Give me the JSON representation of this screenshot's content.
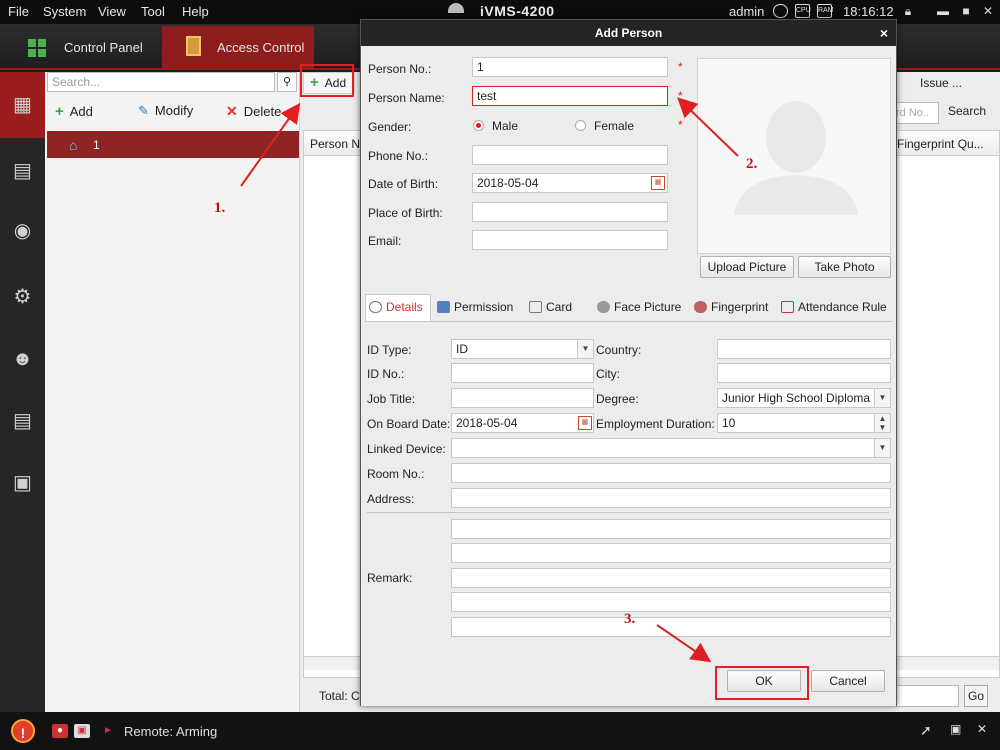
{
  "menubar": {
    "items": [
      "File",
      "System",
      "View",
      "Tool",
      "Help"
    ],
    "app_title": "iVMS-4200",
    "user": "admin",
    "icons": [
      "network-icon",
      "cpu-icon",
      "ram-icon"
    ],
    "cpu_label": "CPU",
    "ram_label": "RAM",
    "clock": "18:16:12"
  },
  "tabs": [
    {
      "label": "Control Panel",
      "icon": "grid-icon"
    },
    {
      "label": "Access Control",
      "icon": "door-icon"
    }
  ],
  "leftnav": [
    "org-icon",
    "schedule-icon",
    "shield-icon",
    "settings-icon",
    "person-search-icon",
    "report-icon",
    "device-icon"
  ],
  "orgpane": {
    "search_placeholder": "Search...",
    "add": "Add",
    "modify": "Modify",
    "delete": "Delete",
    "org_row": "1"
  },
  "rightpane": {
    "add_top": "Add",
    "issue": "Issue ...",
    "search_placeholder": "rd No..",
    "search_btn": "Search",
    "col_person": "Person N",
    "col_fingerprint": "Fingerprint Qu...",
    "total": "Total: C",
    "go": "Go"
  },
  "statusbar": {
    "warn_symbol": "!",
    "remote": "Remote: Arming"
  },
  "dialog": {
    "title": "Add Person",
    "close": "×",
    "person_no_label": "Person No.:",
    "person_no": "1",
    "person_name_label": "Person Name:",
    "person_name": "test",
    "gender_label": "Gender:",
    "male": "Male",
    "female": "Female",
    "gender_selected": "Male",
    "phone_label": "Phone No.:",
    "phone": "",
    "dob_label": "Date of Birth:",
    "dob": "2018-05-04",
    "pob_label": "Place of Birth:",
    "pob": "",
    "email_label": "Email:",
    "email": "",
    "required_mark": "*",
    "upload_picture": "Upload Picture",
    "take_photo": "Take Photo",
    "tabs": [
      "Details",
      "Permission",
      "Card",
      "Face Picture",
      "Fingerprint",
      "Attendance Rule"
    ],
    "active_tab": "Details",
    "details": {
      "id_type_label": "ID Type:",
      "id_type": "ID",
      "country_label": "Country:",
      "country": "",
      "id_no_label": "ID No.:",
      "id_no": "",
      "city_label": "City:",
      "city": "",
      "job_title_label": "Job Title:",
      "job_title": "",
      "degree_label": "Degree:",
      "degree": "Junior High School Diploma",
      "onboard_label": "On Board Date:",
      "onboard": "2018-05-04",
      "employment_label": "Employment Duration:",
      "employment": "10",
      "linked_device_label": "Linked Device:",
      "linked_device": "",
      "room_label": "Room No.:",
      "room": "",
      "address_label": "Address:",
      "address": "",
      "remark_label": "Remark:"
    },
    "ok": "OK",
    "cancel": "Cancel"
  },
  "annotations": {
    "step1": "1.",
    "step2": "2.",
    "step3": "3.",
    "color": "#e02020"
  }
}
